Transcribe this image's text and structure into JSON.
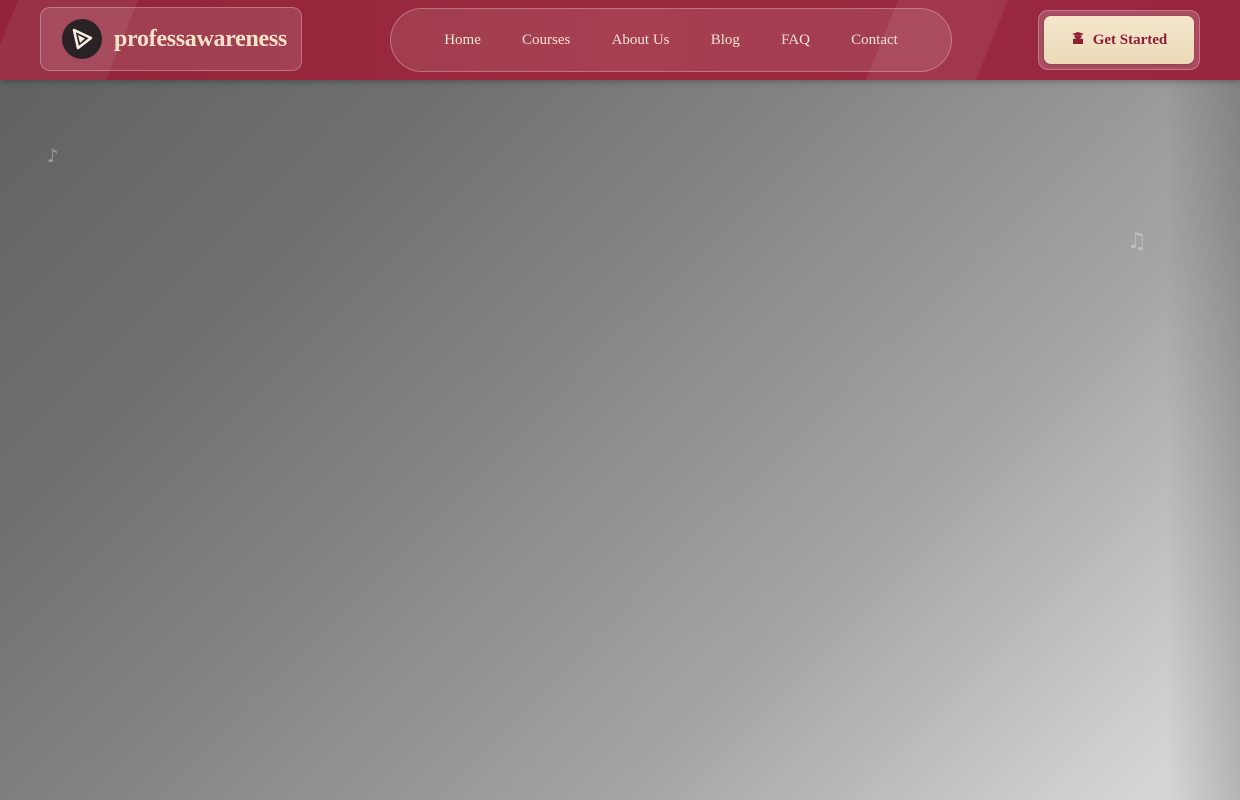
{
  "brand": {
    "name": "professawareness",
    "logo_icon": "play-triangle-icon"
  },
  "nav": {
    "items": [
      {
        "label": "Home"
      },
      {
        "label": "Courses"
      },
      {
        "label": "About Us"
      },
      {
        "label": "Blog"
      },
      {
        "label": "FAQ"
      },
      {
        "label": "Contact"
      }
    ]
  },
  "cta": {
    "label": "Get Started",
    "icon": "graduate-icon"
  },
  "decorations": {
    "note_1": "♪",
    "note_2": "♫"
  },
  "colors": {
    "header_bg": "#9c2a3f",
    "brand_text": "#f3e2c8",
    "cta_bg": "#f5e6cc",
    "cta_text": "#8c1f34"
  }
}
